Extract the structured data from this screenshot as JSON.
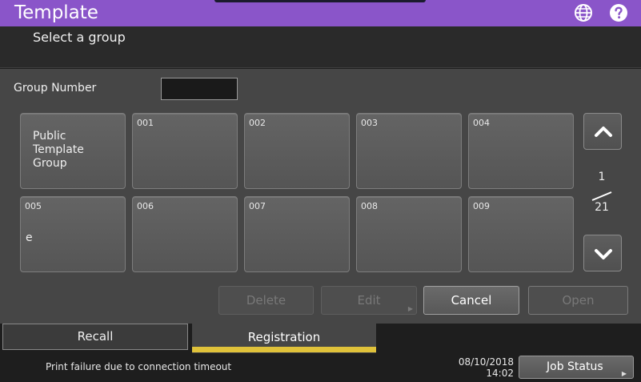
{
  "header": {
    "title": "Template",
    "globe_icon": "globe-icon",
    "help_icon": "help-icon"
  },
  "subtitle": "Select a group",
  "group_number": {
    "label": "Group Number",
    "value": ""
  },
  "tiles": [
    {
      "public_lines": [
        "Public",
        "Template",
        "Group"
      ]
    },
    {
      "number": "001",
      "name": ""
    },
    {
      "number": "002",
      "name": ""
    },
    {
      "number": "003",
      "name": ""
    },
    {
      "number": "004",
      "name": ""
    },
    {
      "number": "005",
      "name": "e"
    },
    {
      "number": "006",
      "name": ""
    },
    {
      "number": "007",
      "name": ""
    },
    {
      "number": "008",
      "name": ""
    },
    {
      "number": "009",
      "name": ""
    }
  ],
  "pager": {
    "current": "1",
    "total": "21",
    "up_icon": "chevron-up-icon",
    "down_icon": "chevron-down-icon"
  },
  "actions": {
    "delete": "Delete",
    "edit": "Edit",
    "cancel": "Cancel",
    "open": "Open"
  },
  "tabs": {
    "recall": "Recall",
    "registration": "Registration",
    "active": "registration"
  },
  "status": {
    "message": "Print failure due to connection timeout",
    "date": "08/10/2018",
    "time": "14:02",
    "job_status": "Job Status"
  },
  "colors": {
    "header": "#8a55c9",
    "panel": "#464646",
    "active_tab_underline": "#e0c23a"
  }
}
